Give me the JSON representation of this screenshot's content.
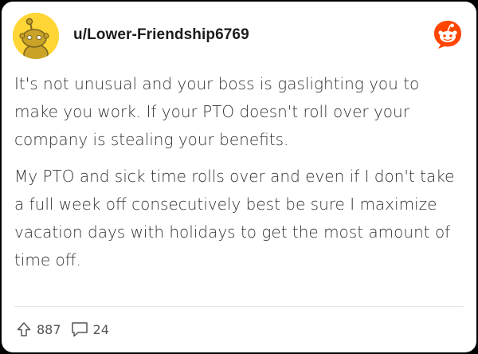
{
  "post": {
    "username": "u/Lower-Friendship6769",
    "paragraphs": [
      "It's not unusual and your boss is gaslighting you to make you work. If your PTO doesn't roll over your company is stealing your benefits.",
      "My PTO and sick time rolls over and even if I don't take a full week off consecutively best be sure I maximize vacation days with holidays to get the most amount of time off."
    ],
    "upvotes": "887",
    "comments": "24"
  },
  "icons": {
    "avatar": "snoo-avatar",
    "brand": "reddit-logo-icon",
    "upvote": "upvote-arrow-icon",
    "comment": "comment-bubble-icon"
  },
  "colors": {
    "brand": "#ff4500",
    "avatar_bg": "#ffd635",
    "text": "#333333"
  }
}
